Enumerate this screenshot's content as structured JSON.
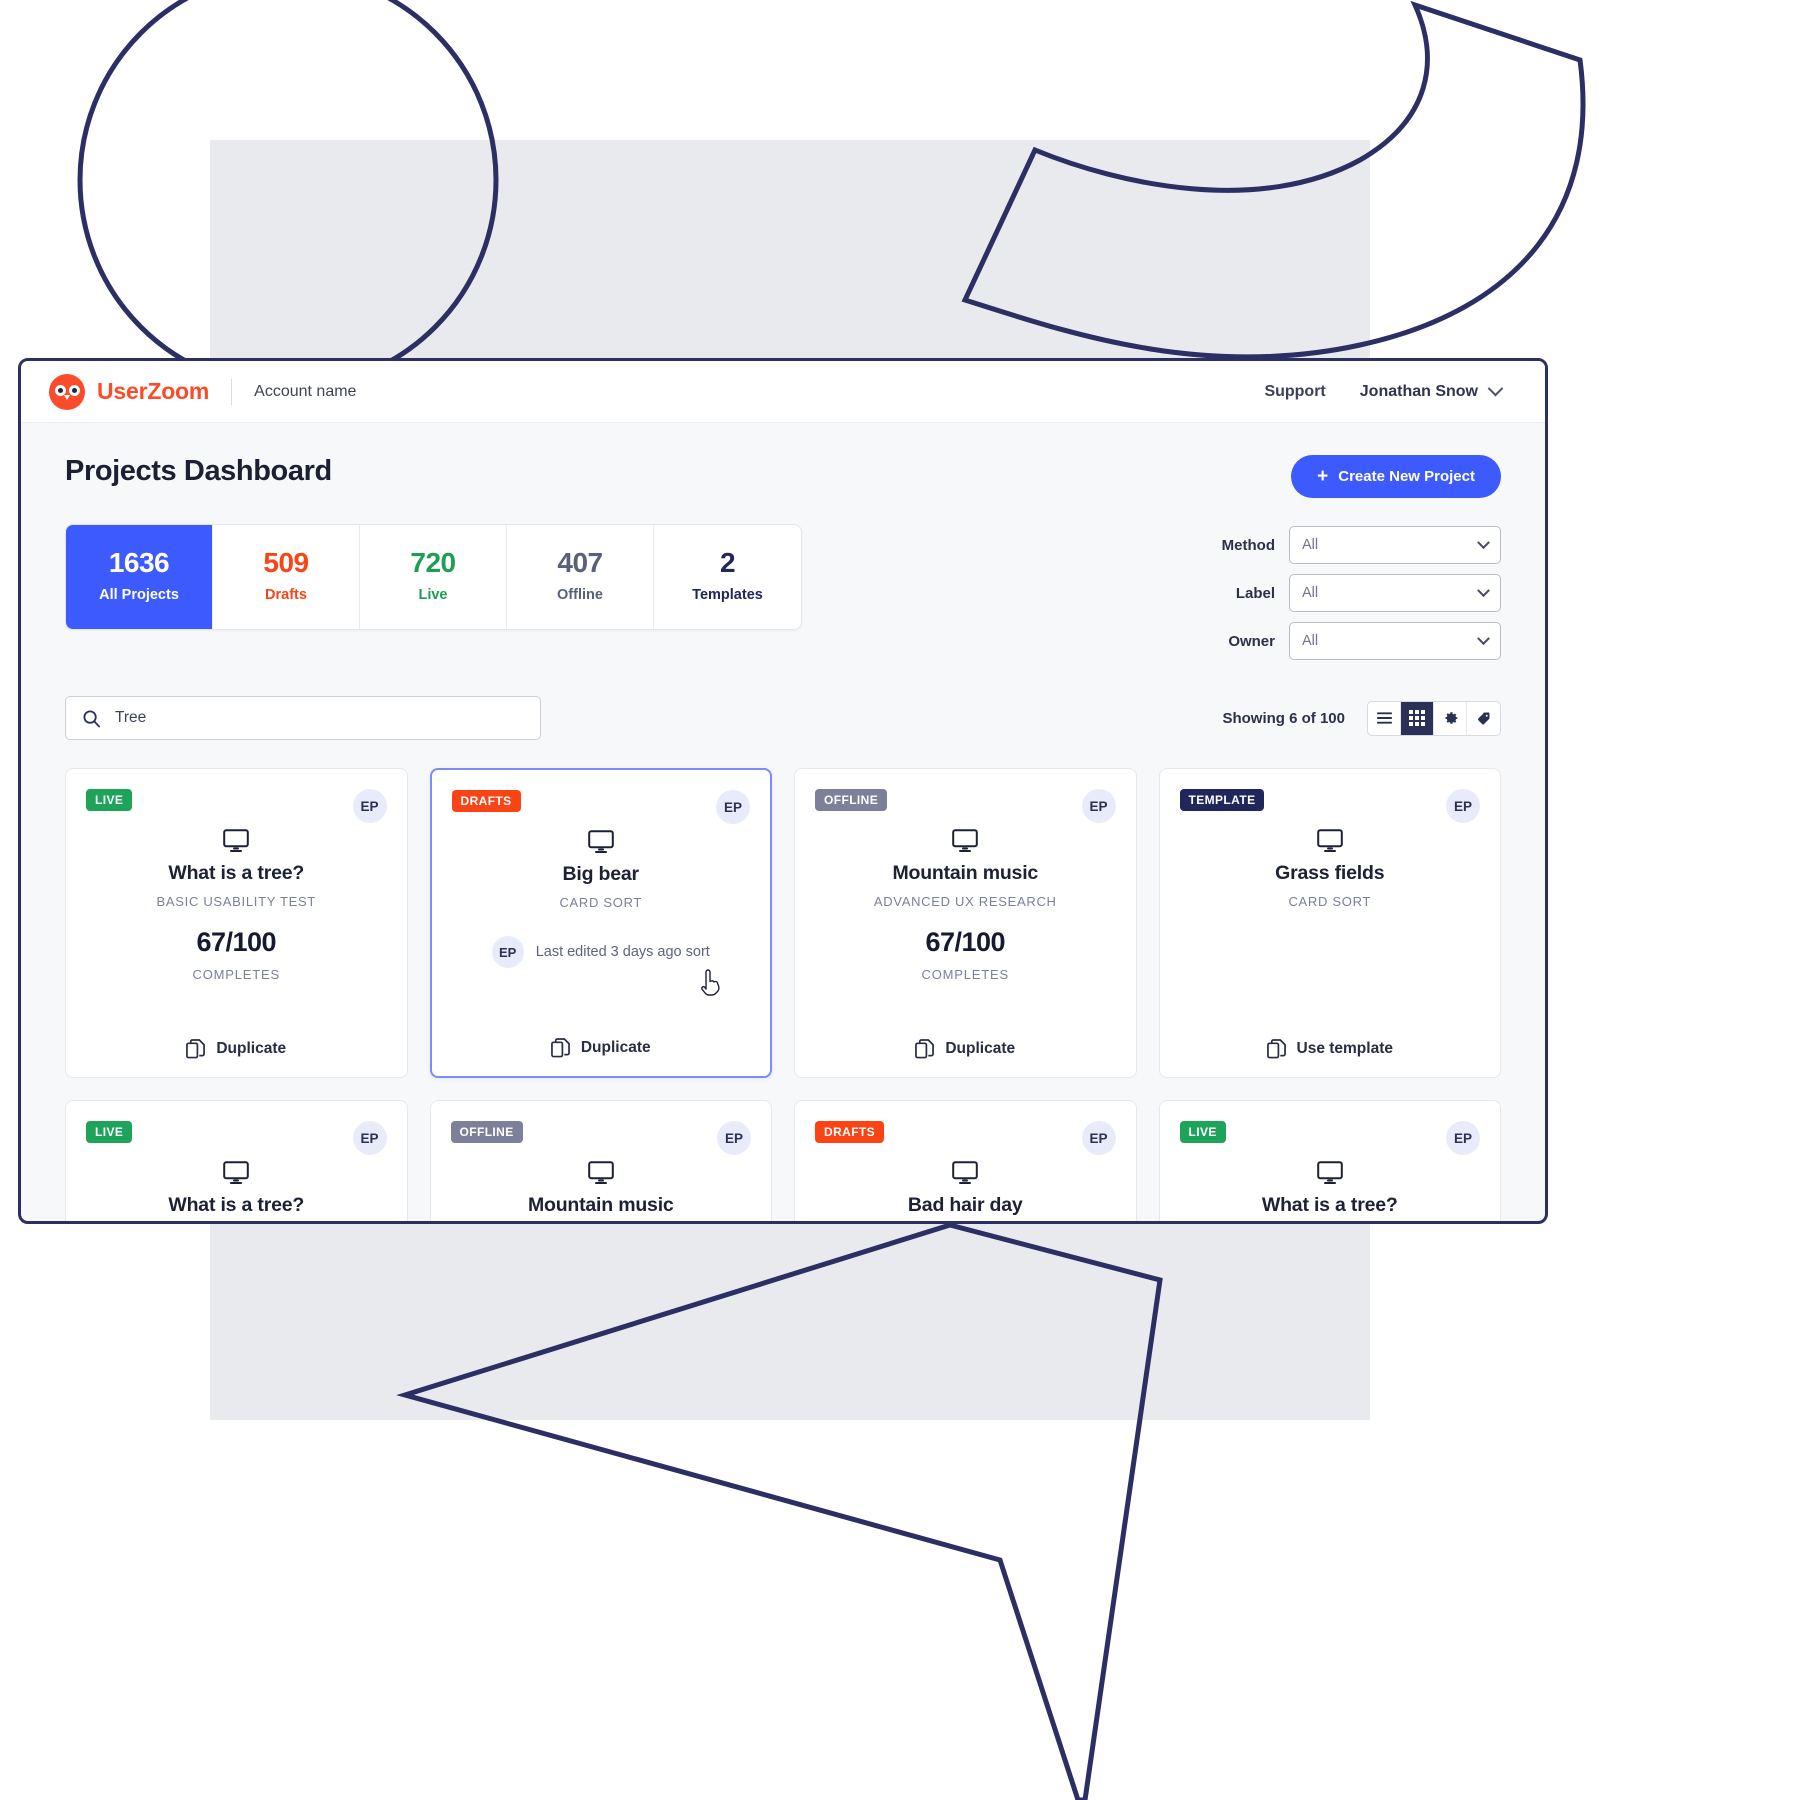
{
  "topbar": {
    "brand_name": "UserZoom",
    "account_name": "Account name",
    "support_label": "Support",
    "user_name": "Jonathan Snow"
  },
  "page": {
    "title": "Projects Dashboard",
    "create_button": "Create New Project",
    "create_icon": "plus-icon"
  },
  "stats": [
    {
      "num": "1636",
      "label": "All Projects",
      "active": true
    },
    {
      "num": "509",
      "label": "Drafts",
      "active": false
    },
    {
      "num": "720",
      "label": "Live",
      "active": false
    },
    {
      "num": "407",
      "label": "Offline",
      "active": false
    },
    {
      "num": "2",
      "label": "Templates",
      "active": false
    }
  ],
  "filters": [
    {
      "label": "Method",
      "value": "All"
    },
    {
      "label": "Label",
      "value": "All"
    },
    {
      "label": "Owner",
      "value": "All"
    }
  ],
  "toolbar": {
    "search_value": "Tree",
    "search_placeholder": "Search",
    "showing": "Showing 6 of 100",
    "views": [
      {
        "icon": "list-view-icon",
        "active": false
      },
      {
        "icon": "grid-view-icon",
        "active": true
      },
      {
        "icon": "gear-icon",
        "active": false
      },
      {
        "icon": "tag-icon",
        "active": false
      }
    ]
  },
  "cards": [
    {
      "badge": "LIVE",
      "badge_type": "live",
      "avatar": "EP",
      "title": "What is a tree?",
      "method": "BASIC USABILITY TEST",
      "score": "67/100",
      "score_label": "COMPLETES",
      "meta": "",
      "action": "Duplicate",
      "selected": false
    },
    {
      "badge": "DRAFTS",
      "badge_type": "drafts",
      "avatar": "EP",
      "title": "Big bear",
      "method": "CARD SORT",
      "score": "",
      "score_label": "",
      "meta": "Last edited 3 days ago sort",
      "meta_avatar": "EP",
      "action": "Duplicate",
      "selected": true
    },
    {
      "badge": "OFFLINE",
      "badge_type": "offline",
      "avatar": "EP",
      "title": "Mountain music",
      "method": "ADVANCED UX RESEARCH",
      "score": "67/100",
      "score_label": "COMPLETES",
      "meta": "",
      "action": "Duplicate",
      "selected": false
    },
    {
      "badge": "TEMPLATE",
      "badge_type": "template",
      "avatar": "EP",
      "title": "Grass fields",
      "method": "CARD SORT",
      "score": "",
      "score_label": "",
      "meta": "",
      "action": "Use template",
      "selected": false
    }
  ],
  "cards_row2": [
    {
      "badge": "LIVE",
      "badge_type": "live",
      "avatar": "EP",
      "title": "What is a tree?"
    },
    {
      "badge": "OFFLINE",
      "badge_type": "offline",
      "avatar": "EP",
      "title": "Mountain music"
    },
    {
      "badge": "DRAFTS",
      "badge_type": "drafts",
      "avatar": "EP",
      "title": "Bad hair day"
    },
    {
      "badge": "LIVE",
      "badge_type": "live",
      "avatar": "EP",
      "title": "What is a tree?"
    }
  ],
  "colors": {
    "accent": "#3d5afe",
    "brand": "#fa4b2a",
    "live": "#1ea35a",
    "drafts": "#fb4416",
    "offline": "#7c8099",
    "template": "#21265c",
    "window_border": "#2b2f63"
  }
}
